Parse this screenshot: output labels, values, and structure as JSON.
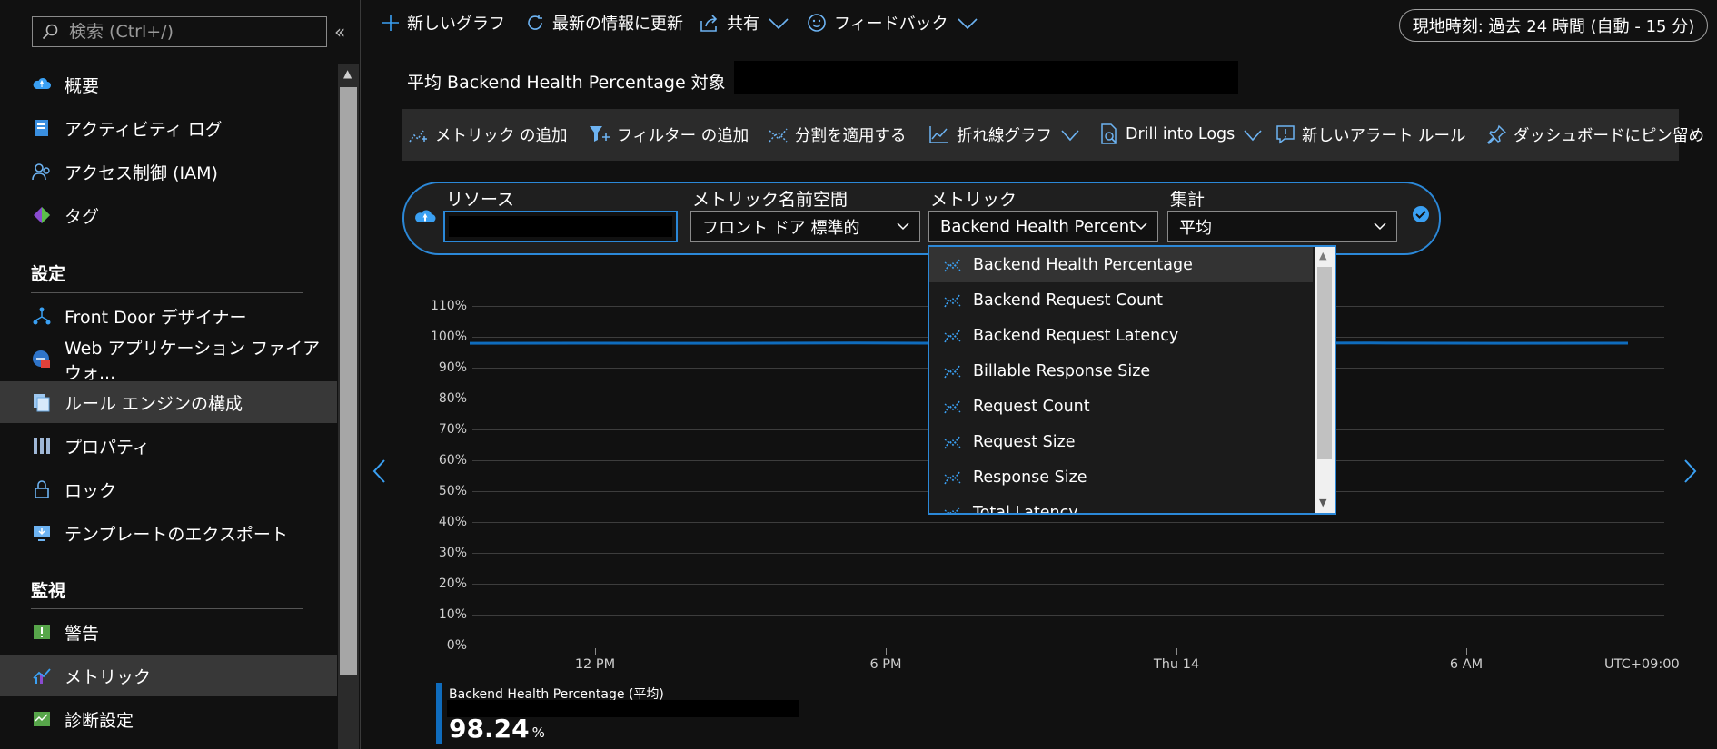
{
  "search": {
    "placeholder": "検索 (Ctrl+/)"
  },
  "sidebar": {
    "top_items": [
      {
        "label": "概要",
        "icon": "overview-cloud-icon"
      },
      {
        "label": "アクティビティ ログ",
        "icon": "activity-log-icon"
      },
      {
        "label": "アクセス制御 (IAM)",
        "icon": "access-control-icon"
      },
      {
        "label": "タグ",
        "icon": "tag-icon"
      }
    ],
    "settings_header": "設定",
    "settings_items": [
      {
        "label": "Front Door デザイナー",
        "icon": "designer-icon"
      },
      {
        "label": "Web アプリケーション ファイアウォ...",
        "icon": "waf-icon"
      },
      {
        "label": "ルール エンジンの構成",
        "icon": "rules-engine-icon",
        "selected": true
      },
      {
        "label": "プロパティ",
        "icon": "properties-icon"
      },
      {
        "label": "ロック",
        "icon": "lock-icon"
      },
      {
        "label": "テンプレートのエクスポート",
        "icon": "export-template-icon"
      }
    ],
    "monitoring_header": "監視",
    "monitoring_items": [
      {
        "label": "警告",
        "icon": "alert-icon"
      },
      {
        "label": "メトリック",
        "icon": "metrics-icon",
        "selected": true
      },
      {
        "label": "診断設定",
        "icon": "diagnostic-icon"
      }
    ]
  },
  "toolbar": {
    "new_chart": "新しいグラフ",
    "refresh": "最新の情報に更新",
    "share": "共有",
    "feedback": "フィードバック",
    "time_range": "現地時刻: 過去 24 時間 (自動 - 15 分)"
  },
  "chart_title_prefix": "平均 Backend Health Percentage 対象",
  "chart_toolbar": {
    "add_metric": "メトリック の追加",
    "add_filter": "フィルター の追加",
    "apply_split": "分割を適用する",
    "line_chart": "折れ線グラフ",
    "drill_logs": "Drill into Logs",
    "new_alert": "新しいアラート ルール",
    "pin_dashboard": "ダッシュボードにピン留め"
  },
  "selector": {
    "resource_label": "リソース",
    "namespace_label": "メトリック名前空間",
    "namespace_value": "フロント ドア 標準的",
    "metric_label": "メトリック",
    "metric_value": "Backend Health Percent",
    "aggregation_label": "集計",
    "aggregation_value": "平均"
  },
  "dropdown": {
    "options": [
      "Backend Health Percentage",
      "Backend Request Count",
      "Backend Request Latency",
      "Billable Response Size",
      "Request Count",
      "Request Size",
      "Response Size",
      "Total Latency"
    ],
    "highlighted_index": 0
  },
  "chart_data": {
    "type": "line",
    "y_ticks": [
      "110%",
      "100%",
      "90%",
      "80%",
      "70%",
      "60%",
      "50%",
      "40%",
      "30%",
      "20%",
      "10%",
      "0%"
    ],
    "ylim": [
      0,
      110
    ],
    "x_ticks": [
      "12 PM",
      "6 PM",
      "Thu 14",
      "6 AM"
    ],
    "timezone_label": "UTC+09:00",
    "series": [
      {
        "name": "Backend Health Percentage (平均)",
        "values": [
          98.2,
          98.24,
          98.2,
          98.3,
          98.2,
          98.24,
          98.2,
          98.3,
          98.2,
          98.24
        ]
      }
    ],
    "color": "#0f6cbd"
  },
  "legend": {
    "name": "Backend Health Percentage (平均)",
    "value": "98.24",
    "unit": "%"
  }
}
